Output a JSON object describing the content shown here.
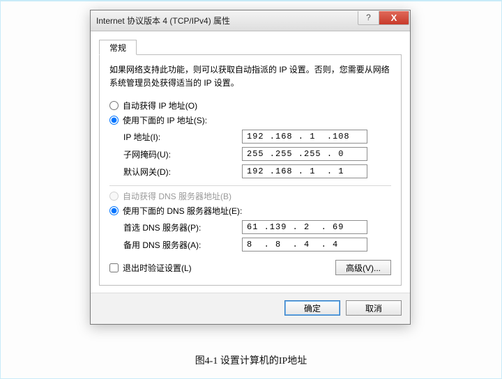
{
  "window": {
    "title": "Internet 协议版本 4 (TCP/IPv4) 属性",
    "help_label": "?",
    "close_label": "X"
  },
  "tab": {
    "general": "常规"
  },
  "description": "如果网络支持此功能，则可以获取自动指派的 IP 设置。否则，您需要从网络系统管理员处获得适当的 IP 设置。",
  "ip_section": {
    "auto_label": "自动获得 IP 地址(O)",
    "manual_label": "使用下面的 IP 地址(S):",
    "ip_label": "IP 地址(I):",
    "ip_value": "192 .168 . 1  .108",
    "mask_label": "子网掩码(U):",
    "mask_value": "255 .255 .255 . 0",
    "gateway_label": "默认网关(D):",
    "gateway_value": "192 .168 . 1  . 1"
  },
  "dns_section": {
    "auto_label": "自动获得 DNS 服务器地址(B)",
    "manual_label": "使用下面的 DNS 服务器地址(E):",
    "preferred_label": "首选 DNS 服务器(P):",
    "preferred_value": "61 .139 . 2  . 69",
    "alternate_label": "备用 DNS 服务器(A):",
    "alternate_value": "8  . 8  . 4  . 4"
  },
  "validate_label": "退出时验证设置(L)",
  "advanced_label": "高级(V)...",
  "ok_label": "确定",
  "cancel_label": "取消",
  "caption": "图4-1  设置计算机的IP地址"
}
